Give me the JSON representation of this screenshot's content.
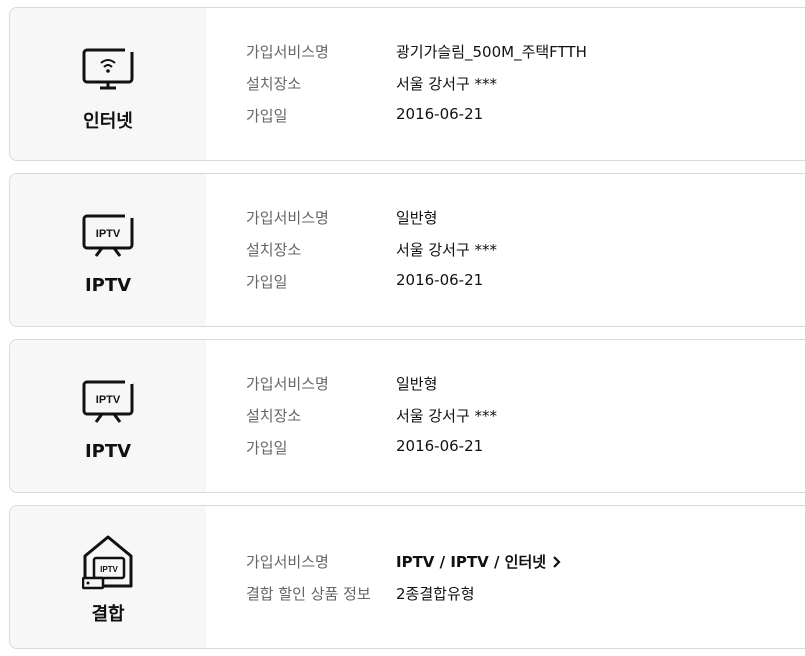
{
  "cards": [
    {
      "service": "인터넷",
      "icon": "monitor-wifi-icon",
      "rows": [
        {
          "label": "가입서비스명",
          "value": "광기가슬림_500M_주택FTTH"
        },
        {
          "label": "설치장소",
          "value": "서울 강서구 ***"
        },
        {
          "label": "가입일",
          "value": "2016-06-21"
        }
      ]
    },
    {
      "service": "IPTV",
      "icon": "tv-icon",
      "icon_text": "IPTV",
      "rows": [
        {
          "label": "가입서비스명",
          "value": "일반형"
        },
        {
          "label": "설치장소",
          "value": "서울 강서구 ***"
        },
        {
          "label": "가입일",
          "value": "2016-06-21"
        }
      ]
    },
    {
      "service": "IPTV",
      "icon": "tv-icon",
      "icon_text": "IPTV",
      "rows": [
        {
          "label": "가입서비스명",
          "value": "일반형"
        },
        {
          "label": "설치장소",
          "value": "서울 강서구 ***"
        },
        {
          "label": "가입일",
          "value": "2016-06-21"
        }
      ]
    },
    {
      "service": "결합",
      "icon": "home-bundle-icon",
      "icon_text": "IPTV",
      "rows": [
        {
          "label": "가입서비스명",
          "value": "IPTV / IPTV / 인터넷"
        },
        {
          "label": "결합 할인 상품 정보",
          "value": "2종결합유형"
        }
      ]
    }
  ],
  "colors": {
    "border": "#d9d9d9",
    "left_panel": "#f7f7f7",
    "label": "#666666",
    "value": "#111111"
  }
}
